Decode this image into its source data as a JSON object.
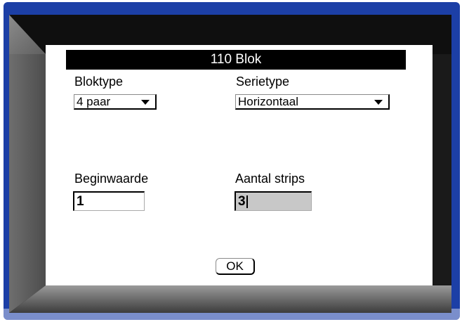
{
  "dialog": {
    "title": "110 Blok",
    "block_type": {
      "label": "Bloktype",
      "value": "4 paar"
    },
    "series_type": {
      "label": "Serietype",
      "value": "Horizontaal"
    },
    "start_value": {
      "label": "Beginwaarde",
      "value": "1"
    },
    "strip_count": {
      "label": "Aantal strips",
      "value": "3"
    },
    "ok_label": "OK"
  },
  "colors": {
    "bezel": "#1c3fa6",
    "title_bar": "#000000",
    "active_field": "#c8c8c8"
  }
}
